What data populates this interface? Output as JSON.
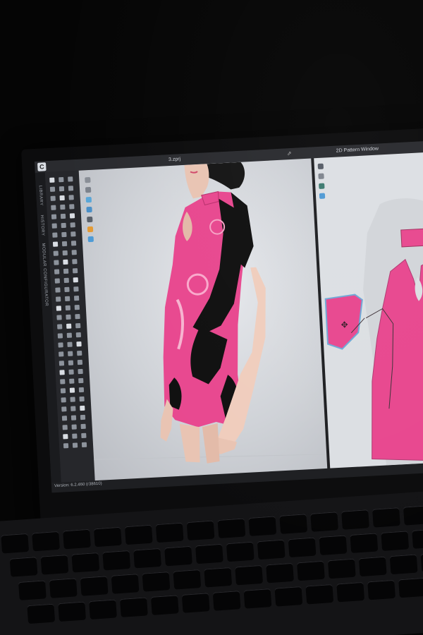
{
  "app": {
    "logo_letter": "C",
    "file_title": "3.zprj",
    "pattern_window_title": "2D Pattern Window",
    "version_text": "Version: 6.2.460 (r38610)"
  },
  "dock_tabs": [
    "LIBRARY",
    "HISTORY",
    "MODULAR CONFIGURATOR"
  ],
  "colors": {
    "garment_pink": "#e8488f",
    "garment_black": "#101010",
    "pattern_outline": "#6fa9d6",
    "viewport_bg": "#d6d9de"
  },
  "icons": [
    "logo-icon",
    "share-icon",
    "toolbar-tool-icon",
    "viewport-tool-icon",
    "pattern-tool-icon",
    "move-cursor-icon"
  ]
}
